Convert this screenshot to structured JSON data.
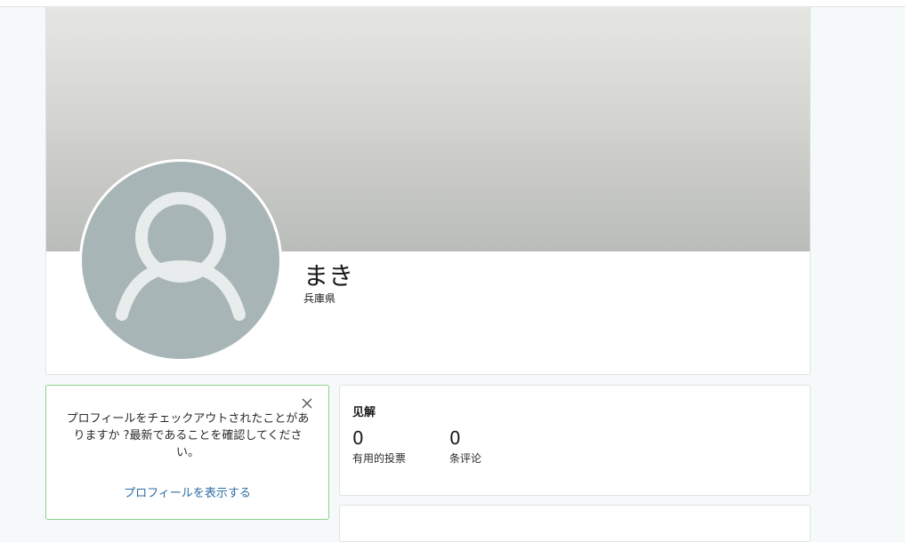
{
  "profile": {
    "name": "まき",
    "location": "兵庫県"
  },
  "prompt": {
    "message": "プロフィールをチェックアウトされたことがありますか ?最新であることを確認してください。",
    "link_label": "プロフィールを表示する"
  },
  "stats": {
    "title": "见解",
    "items": [
      {
        "value": "0",
        "label": "有用的投票"
      },
      {
        "value": "0",
        "label": "条评论"
      }
    ]
  },
  "icons": {
    "avatar": "default-user-icon",
    "close": "close-icon"
  },
  "colors": {
    "avatar_bg": "#a8b5b6",
    "prompt_border": "#8ed08e",
    "link": "#2c6da4"
  }
}
